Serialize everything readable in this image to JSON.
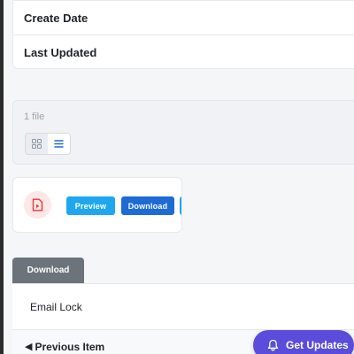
{
  "details": {
    "rows": [
      {
        "label": "Create Date"
      },
      {
        "label": "Last Updated"
      }
    ]
  },
  "files": {
    "count_text": "1 file",
    "view_modes": [
      "grid",
      "list"
    ],
    "active_view": "list",
    "items": [
      {
        "type_icon": "pdf-file-icon",
        "preview_label": "Preview",
        "download_label": "Download"
      }
    ]
  },
  "actions": {
    "download_label": "Download"
  },
  "email_lock": {
    "label": "Email Lock"
  },
  "navigation": {
    "prev_arrow": "◀",
    "prev_label": "Previous Item"
  },
  "get_updates": {
    "label": "Get Updates",
    "icon": "bell-icon"
  },
  "colors": {
    "accent_purple": "#5b4cdb",
    "preview_blue": "#1ea7f0",
    "download_blue": "#1e6bd6",
    "download_gray": "#6c737a",
    "pdf_red": "#e53935"
  }
}
